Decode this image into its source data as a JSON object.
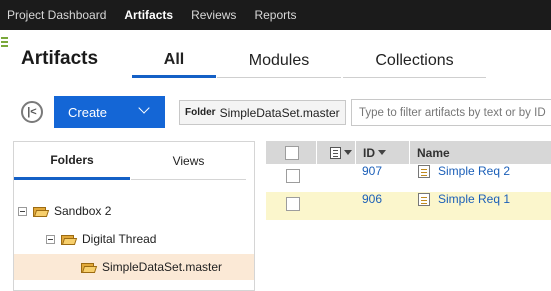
{
  "topnav": {
    "items": [
      {
        "label": "Project Dashboard",
        "active": false
      },
      {
        "label": "Artifacts",
        "active": true
      },
      {
        "label": "Reviews",
        "active": false
      },
      {
        "label": "Reports",
        "active": false
      }
    ]
  },
  "page": {
    "title": "Artifacts",
    "tabs": [
      {
        "label": "All",
        "active": true
      },
      {
        "label": "Modules",
        "active": false
      },
      {
        "label": "Collections",
        "active": false
      }
    ]
  },
  "toolbar": {
    "create_label": "Create",
    "folder_key": "Folder",
    "folder_value": "SimpleDataSet.master",
    "filter_placeholder": "Type to filter artifacts by text or by ID",
    "filter_value": ""
  },
  "left_panel": {
    "tabs": [
      {
        "label": "Folders",
        "active": true
      },
      {
        "label": "Views",
        "active": false
      }
    ],
    "tree": [
      {
        "label": "Sandbox 2",
        "expanded": true,
        "level": 0,
        "selected": false
      },
      {
        "label": "Digital Thread",
        "expanded": true,
        "level": 1,
        "selected": false
      },
      {
        "label": "SimpleDataSet.master",
        "expanded": false,
        "level": 2,
        "selected": true
      }
    ]
  },
  "grid": {
    "columns": [
      "ID",
      "Name"
    ],
    "rows": [
      {
        "id": "907",
        "name": "Simple Req 2",
        "highlighted": false
      },
      {
        "id": "906",
        "name": "Simple Req 1",
        "highlighted": true
      }
    ]
  },
  "colors": {
    "topnav_bg": "#1b1b1b",
    "accent": "#1460c6",
    "create_button": "#1466d6",
    "selected_tree_row": "#fbe9d6",
    "highlight_row": "#fbf6cc",
    "link": "#1b5fb8"
  },
  "icons": {
    "back": "back-arrow-icon",
    "create_dropdown": "chevron-down-icon",
    "folder": "folder-icon",
    "artifact": "requirement-document-icon",
    "column_menu": "column-options-icon",
    "sort": "sort-descending-icon",
    "tree_toggle": "collapse-icon"
  }
}
